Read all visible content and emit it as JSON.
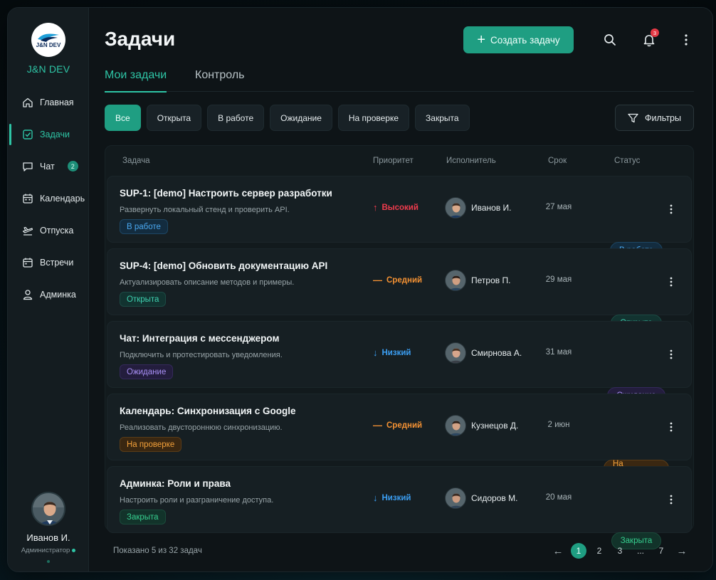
{
  "brand": {
    "logo_text": "J&N DEV",
    "name": "J&N DEV",
    "accent": "#2ec4a5"
  },
  "sidebar": {
    "items": [
      {
        "label": "Главная",
        "icon": "home-icon"
      },
      {
        "label": "Задачи",
        "icon": "checkbox-icon",
        "active": true
      },
      {
        "label": "Чат",
        "icon": "chat-icon",
        "badge": "2"
      },
      {
        "label": "Календарь",
        "icon": "calendar-icon"
      },
      {
        "label": "Отпуска",
        "icon": "plane-icon"
      },
      {
        "label": "Встречи",
        "icon": "calendar-icon"
      },
      {
        "label": "Админка",
        "icon": "user-icon"
      }
    ]
  },
  "profile": {
    "name": "Иванов И.",
    "role": "Администратор"
  },
  "header": {
    "title": "Задачи",
    "create_label": "Создать задачу",
    "notifications_count": "3"
  },
  "tabs": [
    {
      "label": "Мои задачи",
      "active": true
    },
    {
      "label": "Контроль"
    }
  ],
  "chips": [
    {
      "label": "Все",
      "active": true
    },
    {
      "label": "Открыта"
    },
    {
      "label": "В работе"
    },
    {
      "label": "Ожидание"
    },
    {
      "label": "На проверке"
    },
    {
      "label": "Закрыта"
    }
  ],
  "filters_label": "Фильтры",
  "table": {
    "columns": [
      "Задача",
      "Приоритет",
      "Исполнитель",
      "Срок",
      "Статус"
    ],
    "rows": [
      {
        "title": "SUP-1: [demo] Настроить сервер разработки",
        "desc": "Развернуть локальный стенд и проверить API.",
        "tag": "В работе",
        "tag_color": "blue",
        "priority": "Высокий",
        "priority_icon": "↑",
        "priority_color": "#ef3b4d",
        "assignee": "Иванов И.",
        "due": "27 мая",
        "status": "В работе",
        "status_color": "blue"
      },
      {
        "title": "SUP-4: [demo] Обновить документацию API",
        "desc": "Актуализировать описание методов и примеры.",
        "tag": "Открыта",
        "tag_color": "teal",
        "priority": "Средний",
        "priority_icon": "—",
        "priority_color": "#f39133",
        "assignee": "Петров П.",
        "due": "29 мая",
        "status": "Открыта",
        "status_color": "teal"
      },
      {
        "title": "Чат: Интеграция с мессенджером",
        "desc": "Подключить и протестировать уведомления.",
        "tag": "Ожидание",
        "tag_color": "purple",
        "priority": "Низкий",
        "priority_icon": "↓",
        "priority_color": "#3b9ef2",
        "assignee": "Смирнова А.",
        "due": "31 мая",
        "status": "Ожидание",
        "status_color": "purple"
      },
      {
        "title": "Календарь: Синхронизация с Google",
        "desc": "Реализовать двустороннюю синхронизацию.",
        "tag": "На проверке",
        "tag_color": "orange",
        "priority": "Средний",
        "priority_icon": "—",
        "priority_color": "#f39133",
        "assignee": "Кузнецов Д.",
        "due": "2 июн",
        "status": "На проверке",
        "status_color": "orange"
      },
      {
        "title": "Админка: Роли и права",
        "desc": "Настроить роли и разграничение доступа.",
        "tag": "Закрыта",
        "tag_color": "green",
        "priority": "Низкий",
        "priority_icon": "↓",
        "priority_color": "#3b9ef2",
        "assignee": "Сидоров М.",
        "due": "20 мая",
        "status": "Закрыта",
        "status_color": "green"
      }
    ]
  },
  "footer": {
    "info": "Показано 5 из 32 задач",
    "pages": [
      "1",
      "2",
      "3",
      "...",
      "7"
    ],
    "current_page": "1",
    "prev_icon": "←",
    "next_icon": "→"
  }
}
